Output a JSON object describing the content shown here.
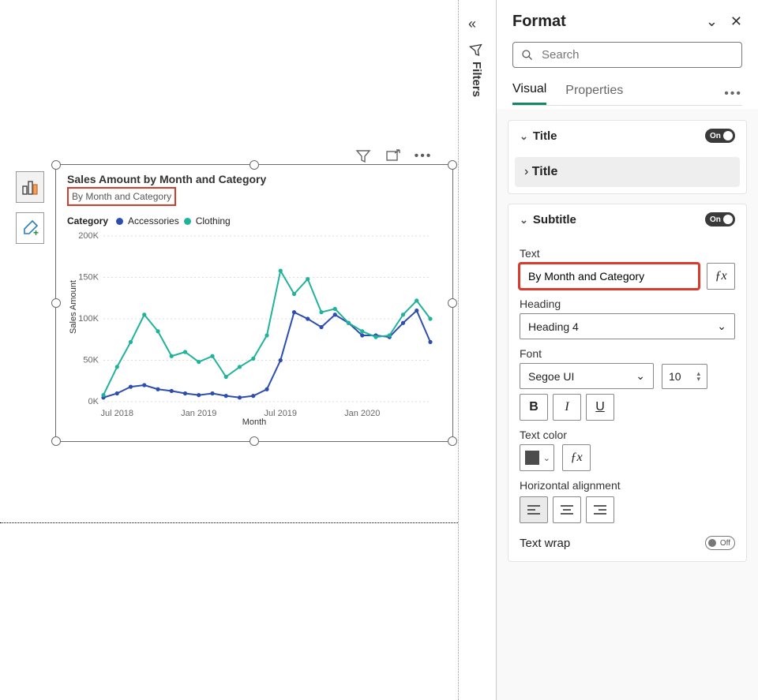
{
  "filters": {
    "label": "Filters"
  },
  "visual": {
    "title": "Sales Amount by Month and Category",
    "subtitle": "By Month and Category",
    "legend_label": "Category",
    "legend": [
      {
        "name": "Accessories",
        "color": "#2d4db1"
      },
      {
        "name": "Clothing",
        "color": "#21b39a"
      }
    ],
    "y_axis_title": "Sales Amount",
    "x_axis_title": "Month",
    "y_ticks": [
      "0K",
      "50K",
      "100K",
      "150K",
      "200K"
    ],
    "x_ticks": [
      "Jul 2018",
      "Jan 2019",
      "Jul 2019",
      "Jan 2020"
    ]
  },
  "chart_data": {
    "type": "line",
    "title": "Sales Amount by Month and Category",
    "subtitle": "By Month and Category",
    "xlabel": "Month",
    "ylabel": "Sales Amount",
    "ylim": [
      0,
      200000
    ],
    "categories": [
      "Jun 2018",
      "Jul 2018",
      "Aug 2018",
      "Sep 2018",
      "Oct 2018",
      "Nov 2018",
      "Dec 2018",
      "Jan 2019",
      "Feb 2019",
      "Mar 2019",
      "Apr 2019",
      "May 2019",
      "Jun 2019",
      "Jul 2019",
      "Aug 2019",
      "Sep 2019",
      "Oct 2019",
      "Nov 2019",
      "Dec 2019",
      "Jan 2020",
      "Feb 2020",
      "Mar 2020",
      "Apr 2020",
      "May 2020",
      "Jun 2020"
    ],
    "series": [
      {
        "name": "Accessories",
        "color": "#2d4db1",
        "values": [
          5000,
          10000,
          18000,
          20000,
          15000,
          13000,
          10000,
          8000,
          10000,
          7000,
          5000,
          7000,
          15000,
          50000,
          108000,
          100000,
          90000,
          105000,
          95000,
          80000,
          80000,
          78000,
          95000,
          110000,
          72000
        ]
      },
      {
        "name": "Clothing",
        "color": "#21b39a",
        "values": [
          8000,
          42000,
          72000,
          105000,
          85000,
          55000,
          60000,
          48000,
          55000,
          30000,
          42000,
          52000,
          80000,
          158000,
          130000,
          148000,
          108000,
          112000,
          95000,
          85000,
          78000,
          80000,
          105000,
          122000,
          100000
        ]
      }
    ]
  },
  "pane": {
    "title": "Format",
    "search_placeholder": "Search",
    "tabs": {
      "visual": "Visual",
      "properties": "Properties"
    },
    "title_card": {
      "label": "Title",
      "on_label": "On",
      "sub_label": "Title"
    },
    "subtitle_card": {
      "label": "Subtitle",
      "on_label": "On",
      "text_label": "Text",
      "text_value": "By Month and Category",
      "heading_label": "Heading",
      "heading_value": "Heading 4",
      "font_label": "Font",
      "font_value": "Segoe UI",
      "font_size": "10",
      "bold": "B",
      "italic": "I",
      "underline": "U",
      "text_color_label": "Text color",
      "align_label": "Horizontal alignment",
      "wrap_label": "Text wrap",
      "off_label": "Off"
    }
  }
}
